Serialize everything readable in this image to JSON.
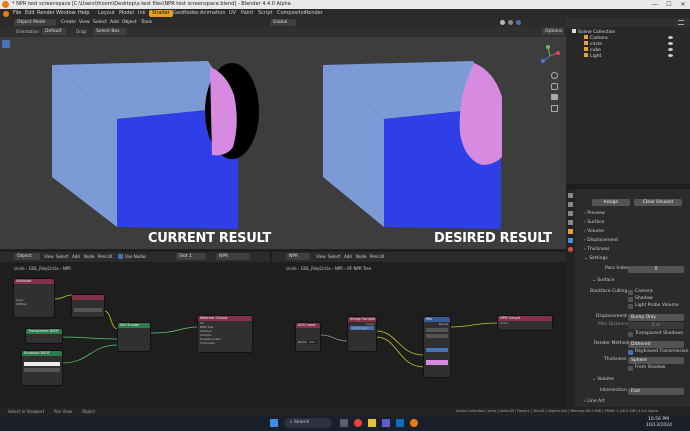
{
  "window": {
    "title": "* NPR test screenspace [C:\\Users\\thoom\\Desktop\\x-test files\\NPR test screenspace.blend] - Blender 4.4.0 Alpha",
    "minimize": "—",
    "maximize": "☐",
    "close": "✕"
  },
  "menubar": {
    "menus": [
      "File",
      "Edit",
      "Render",
      "Window",
      "Help"
    ],
    "workspaces": [
      "Layout",
      "Model",
      "Ink",
      "Shader",
      "GeoNodes",
      "Animation",
      "UV",
      "Paint",
      "Script",
      "Compositor",
      "Render"
    ],
    "active_workspace": "Shader",
    "scene_label": "Scene",
    "viewlayer_label": "ViewLayer"
  },
  "viewport": {
    "mode": "Object Mode",
    "menus": [
      "Create",
      "View",
      "Select",
      "Add",
      "Object",
      "Tools"
    ],
    "transform": "Global",
    "orientation_label": "Orientation:",
    "orientation_value": "Default",
    "drag_label": "Drag:",
    "drag_value": "Select Box",
    "options": "Options",
    "label_left": "CURRENT RESULT",
    "label_right": "DESIRED RESULT"
  },
  "outliner": {
    "root": "Scene Collection",
    "items": [
      "Camera",
      "circle",
      "cube",
      "Light"
    ]
  },
  "properties": {
    "tab_assign": "Assign",
    "tab_clear": "Clear Unused",
    "panels": [
      "Preview",
      "Surface",
      "Volume",
      "Displacement",
      "Thickness",
      "Settings"
    ],
    "pass_index_label": "Pass Index",
    "pass_index_value": "0",
    "surface_label": "Surface",
    "backface_label": "Backface Culling",
    "camera": "Camera",
    "shadow": "Shadow",
    "light_probe": "Light Probe Volume",
    "displacement_label": "Displacement",
    "displacement_value": "Bump Only",
    "max_distance_label": "Max Distance",
    "max_distance_value": "0 m",
    "transparent_shadows": "Transparent Shadows",
    "render_method_label": "Render Method",
    "render_method_value": "Dithered",
    "raytraced": "Raytraced Transmission",
    "thickness_label": "Thickness",
    "thickness_value": "Sphere",
    "from_shadow": "From Shadow",
    "volume_label": "Volume",
    "intersection_label": "Intersection",
    "intersection_value": "Fast",
    "line_art": "Line Art"
  },
  "node_editor_left": {
    "type": "Object",
    "menus": [
      "View",
      "Select",
      "Add",
      "Node",
      "PencilX"
    ],
    "use_nodes": "Use Nodes",
    "slot": "Slot 1",
    "material": "NPR",
    "breadcrumb": [
      "circle",
      "GOL_PolyCircle",
      "NPR"
    ],
    "nodes": {
      "attribute": "Attribute",
      "layer": "layer",
      "uvmap": "UVMap",
      "blank": "",
      "transparent": "Transparent BSDF",
      "emission": "Emission BSDF",
      "mix": "Mix Shader",
      "output": "Material Output",
      "output_target": "All",
      "npr_tree": "NPR Tree",
      "surface": "Surface",
      "volume": "Volume",
      "displacement": "Displacement",
      "thickness": "Thickness"
    }
  },
  "node_editor_right": {
    "type": "NPR",
    "menus": [
      "View",
      "Select",
      "Add",
      "Node",
      "PencilX"
    ],
    "breadcrumb": [
      "circle",
      "GOL_PolyCircle",
      "NPR",
      "RF NPR Tree"
    ],
    "nodes": {
      "aov_input": "AOV Input",
      "aov_name_label": "Name",
      "aov_name": "AOV",
      "image_sample": "Image Sample",
      "color": "Color",
      "combined": "Combined",
      "mix": "Mix",
      "npr_output": "NPR Output",
      "result": "Result"
    }
  },
  "statusbar": {
    "left": [
      "Select in Viewport",
      "Pan View",
      "Object"
    ],
    "right": "Scene Collection | circle | Verts:40 | Faces:1 | Tris:42 | Objects:0/4 | Memory: 80.0 MiB | VRAM: 1.2/8.0 GiB | 4.4.0 Alpha"
  },
  "taskbar": {
    "search": "Search",
    "time": "10:56 PM",
    "date": "10/13/2024"
  },
  "colors": {
    "accent": "#e7a21a",
    "cube_light": "#7c9ad6",
    "cube_blue": "#2e3fe8",
    "circle_pink": "#d68ae0"
  }
}
